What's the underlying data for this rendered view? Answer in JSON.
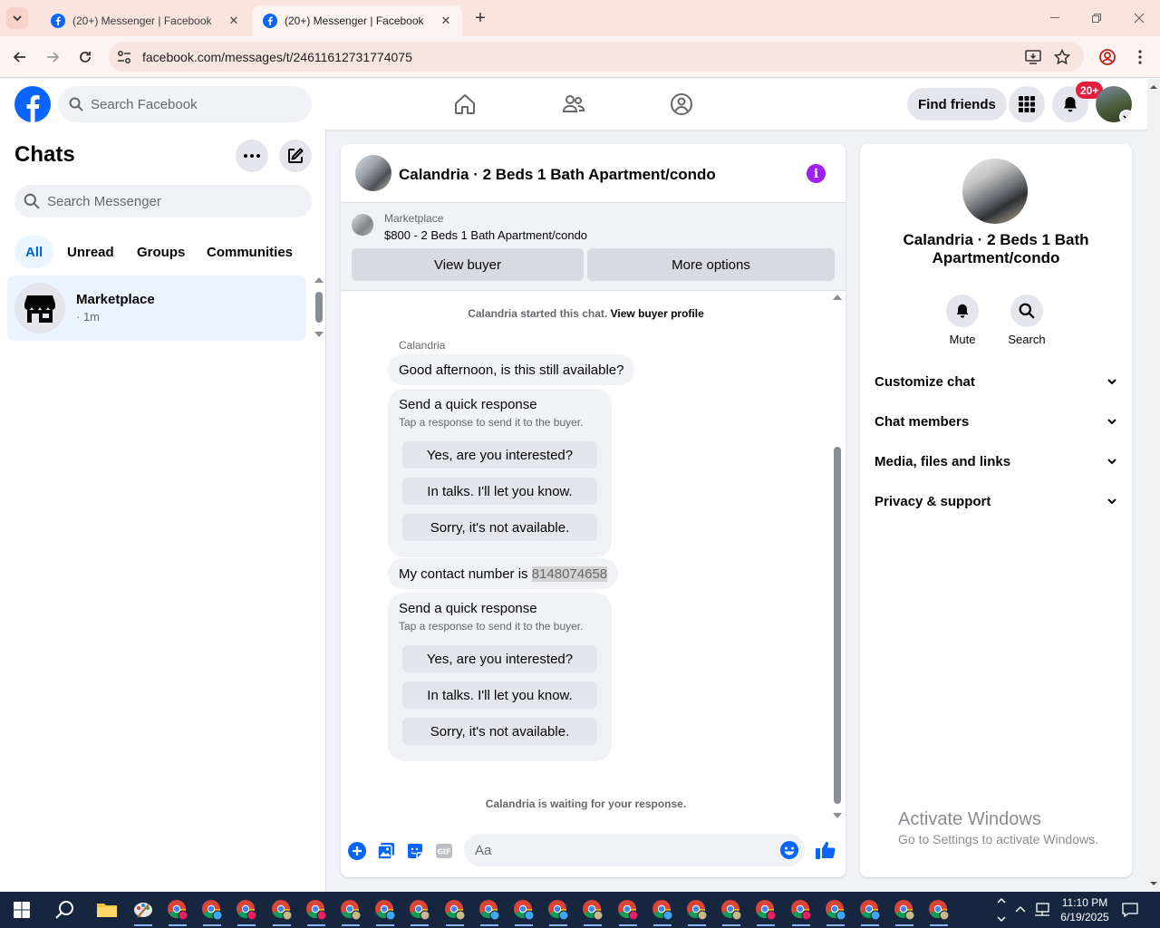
{
  "browser": {
    "tabs": [
      {
        "title": "(20+) Messenger | Facebook"
      },
      {
        "title": "(20+) Messenger | Facebook"
      }
    ],
    "url": "facebook.com/messages/t/24611612731774075"
  },
  "header": {
    "search_placeholder": "Search Facebook",
    "find_friends": "Find friends",
    "notification_badge": "20+"
  },
  "sidebar": {
    "title": "Chats",
    "search_placeholder": "Search Messenger",
    "filters": [
      "All",
      "Unread",
      "Groups",
      "Communities"
    ],
    "chats": [
      {
        "name": "Marketplace",
        "time": "· 1m"
      }
    ]
  },
  "conversation": {
    "title": "Calandria · 2 Beds 1 Bath Apartment/condo",
    "marketplace_label": "Marketplace",
    "listing": "$800 - 2 Beds 1 Bath Apartment/condo",
    "view_buyer": "View buyer",
    "more_options": "More options",
    "started_text": "Calandria started this chat.",
    "view_buyer_profile": "View buyer profile",
    "sender": "Calandria",
    "message1": "Good afternoon, is this still available?",
    "quick_title": "Send a quick response",
    "quick_subtitle": "Tap a response to send it to the buyer.",
    "quick_options": [
      "Yes, are you interested?",
      "In talks. I'll let you know.",
      "Sorry, it's not available."
    ],
    "message2_prefix": "My contact number is ",
    "message2_number": "8148074658",
    "waiting_text": "Calandria is waiting for your response.",
    "composer_placeholder": "Aa"
  },
  "details": {
    "title": "Calandria · 2 Beds 1 Bath Apartment/condo",
    "actions": [
      "Mute",
      "Search"
    ],
    "sections": [
      "Customize chat",
      "Chat members",
      "Media, files and links",
      "Privacy & support"
    ]
  },
  "watermark": {
    "line1": "Activate Windows",
    "line2": "Go to Settings to activate Windows."
  },
  "taskbar": {
    "time": "11:10 PM",
    "date": "6/19/2025"
  },
  "colors": {
    "facebook_blue": "#0866ff",
    "accent_purple": "#a020f0",
    "badge_red": "#e41e3f"
  }
}
